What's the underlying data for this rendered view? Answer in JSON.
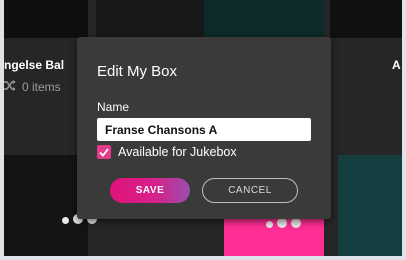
{
  "background_grid": {
    "left_box_title": "ngelse Bal",
    "left_box_count": "0 items",
    "right_box_title_cut": "A"
  },
  "dialog": {
    "title": "Edit My Box",
    "name_label": "Name",
    "name_value": "Franse Chansons A",
    "jukebox_label": "Available for Jukebox",
    "jukebox_checked": true,
    "save_label": "SAVE",
    "cancel_label": "CANCEL"
  },
  "colors": {
    "accent_pink": "#e0127a",
    "dialog_bg": "#3a3a3a",
    "app_bg": "#262626"
  }
}
